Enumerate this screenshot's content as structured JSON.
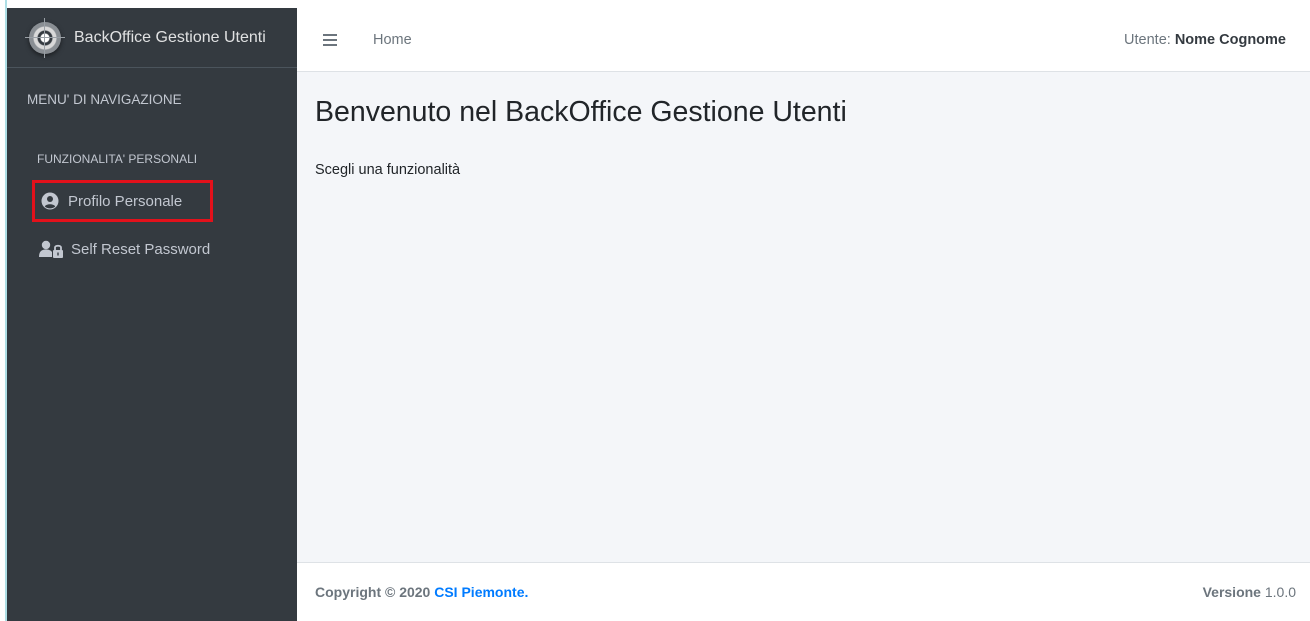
{
  "app": {
    "brand_title": "BackOffice Gestione Utenti",
    "logo_icon": "brand-logo-icon"
  },
  "sidebar": {
    "menu_header": "MENU' DI NAVIGAZIONE",
    "section_title": "FUNZIONALITA' PERSONALI",
    "items": [
      {
        "label": "Profilo Personale",
        "icon": "user-circle-icon",
        "selected": true
      },
      {
        "label": "Self Reset Password",
        "icon": "user-lock-icon",
        "selected": false
      }
    ]
  },
  "topbar": {
    "menu_icon": "hamburger-icon",
    "home_label": "Home",
    "user_label": "Utente:",
    "user_name": "Nome Cognome"
  },
  "main": {
    "title": "Benvenuto nel BackOffice Gestione Utenti",
    "subtitle": "Scegli una funzionalità"
  },
  "footer": {
    "copyright_prefix": "Copyright © 2020",
    "company_link": "CSI Piemonte.",
    "version_label": "Versione",
    "version_value": "1.0.0"
  },
  "colors": {
    "sidebar_bg": "#343a40",
    "content_bg": "#f4f6f9",
    "link": "#007bff",
    "highlight": "#e3111b"
  }
}
